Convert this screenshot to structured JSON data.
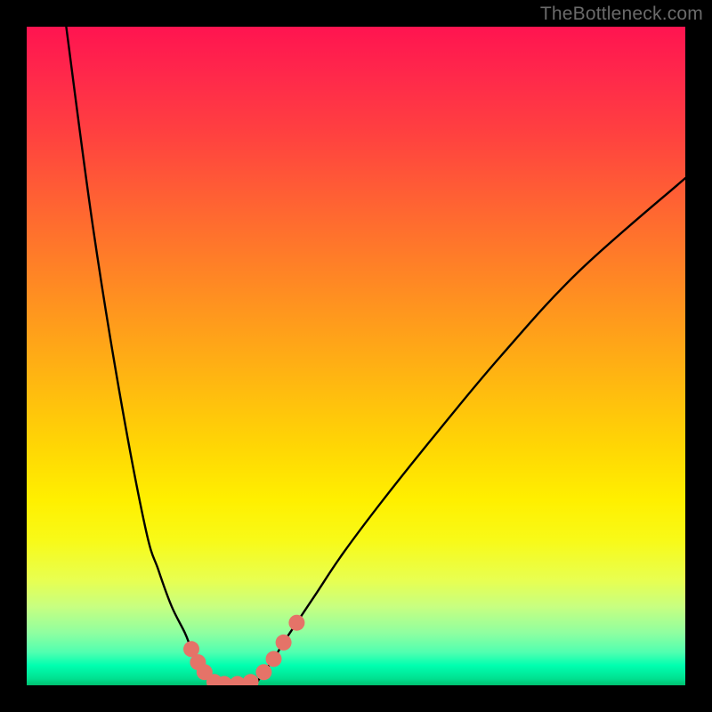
{
  "watermark": "TheBottleneck.com",
  "colors": {
    "frame": "#000000",
    "curve_stroke": "#000000",
    "marker_fill": "#e57368",
    "gradient_top": "#ff1450",
    "gradient_mid": "#fff000",
    "gradient_bottom": "#00c070"
  },
  "chart_data": {
    "type": "line",
    "title": "",
    "xlabel": "",
    "ylabel": "",
    "xlim": [
      0,
      100
    ],
    "ylim": [
      0,
      100
    ],
    "grid": false,
    "legend": null,
    "note": "x and y are percentages of the plot area; y increases downward as drawn (0=top, 100=bottom). The two curves form a V shape meeting at the bottom.",
    "series": [
      {
        "name": "left-curve",
        "x": [
          6,
          10,
          14,
          18,
          20,
          22,
          24,
          25,
          26,
          27,
          28
        ],
        "y": [
          0,
          30,
          55,
          76,
          82.5,
          88,
          92,
          94.5,
          96.5,
          98,
          99.5
        ]
      },
      {
        "name": "right-curve",
        "x": [
          35,
          36,
          37.5,
          39,
          41,
          44,
          48,
          54,
          62,
          72,
          84,
          100
        ],
        "y": [
          99.5,
          98,
          96,
          93.5,
          90.5,
          86,
          80,
          72,
          62,
          50,
          37,
          23
        ]
      },
      {
        "name": "valley-floor",
        "x": [
          28,
          30,
          32,
          34,
          35
        ],
        "y": [
          99.5,
          99.8,
          99.8,
          99.8,
          99.5
        ]
      }
    ],
    "markers": [
      {
        "x": 25.0,
        "y": 94.5
      },
      {
        "x": 26.0,
        "y": 96.5
      },
      {
        "x": 27.0,
        "y": 98.0
      },
      {
        "x": 28.5,
        "y": 99.5
      },
      {
        "x": 30.0,
        "y": 99.8
      },
      {
        "x": 32.0,
        "y": 99.8
      },
      {
        "x": 34.0,
        "y": 99.5
      },
      {
        "x": 36.0,
        "y": 98.0
      },
      {
        "x": 37.5,
        "y": 96.0
      },
      {
        "x": 39.0,
        "y": 93.5
      },
      {
        "x": 41.0,
        "y": 90.5
      }
    ]
  }
}
